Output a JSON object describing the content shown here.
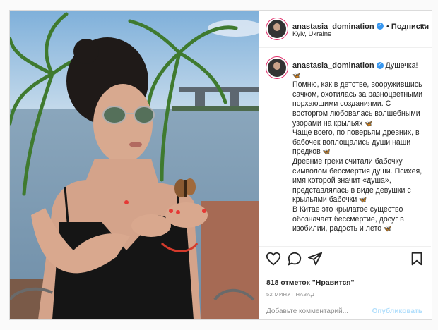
{
  "post": {
    "username": "anastasia_domination",
    "follow_label": "Подписки",
    "location": "Kyiv, Ukraine",
    "more_label": "•••"
  },
  "caption": {
    "username": "anastasia_domination",
    "greeting": "Душечка!",
    "lines": [
      "Помню, как в детстве, вооружившись сачком, охотилась за разноцветными порхающими созданиями. С восторгом любовалась волшебными узорами на крыльях",
      "Чаще всего, по поверьям древних, в бабочек воплощались души наши предков",
      "Древние греки считали бабочку символом бессмертия души. Психея, имя которой значит «душа», представлялась в виде девушки с крыльями бабочки",
      "В Китае это крылатое существо обозначает бессмертие, досуг в изобилии, радость и лето"
    ]
  },
  "stats": {
    "likes": "818 отметок \"Нравится\"",
    "time": "52 МИНУТ НАЗАД"
  },
  "comment": {
    "placeholder": "Добавьте комментарий...",
    "publish_label": "Опубликовать"
  },
  "icons": {
    "like": "heart-icon",
    "comment": "comment-icon",
    "share": "send-icon",
    "save": "bookmark-icon",
    "verified": "verified-badge-icon",
    "butterfly": "butterfly-emoji"
  },
  "colors": {
    "verified": "#3897f0",
    "publish_disabled": "#b2dffc",
    "border": "#dbdbdb"
  }
}
